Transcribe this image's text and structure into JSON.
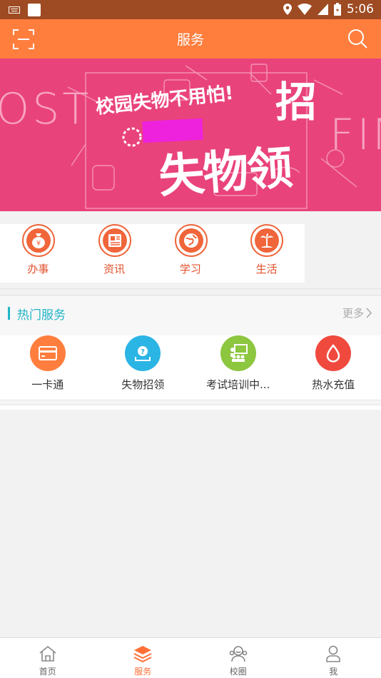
{
  "status_bar": {
    "time": "5:06"
  },
  "app_bar": {
    "title": "服务"
  },
  "banner": {
    "headline": "校园失物不用怕!",
    "big1": "招",
    "big2": "失物领",
    "bg_left": "OST",
    "bg_right": "FIN"
  },
  "categories": [
    {
      "label": "办事",
      "icon": "money-bag-icon"
    },
    {
      "label": "资讯",
      "icon": "news-icon"
    },
    {
      "label": "学习",
      "icon": "globe-icon"
    },
    {
      "label": "生活",
      "icon": "palm-tree-icon"
    }
  ],
  "hot_services": {
    "title": "热门服务",
    "more": "更多",
    "items": [
      {
        "label": "一卡通",
        "icon": "card-icon",
        "color": "#ff7e3e"
      },
      {
        "label": "失物招领",
        "icon": "lost-found-icon",
        "color": "#2bb5e5"
      },
      {
        "label": "考试培训中...",
        "icon": "classroom-icon",
        "color": "#8dc63f"
      },
      {
        "label": "热水充值",
        "icon": "water-drop-icon",
        "color": "#f04a3e"
      }
    ]
  },
  "bottom_nav": [
    {
      "label": "首页",
      "icon": "home-icon"
    },
    {
      "label": "服务",
      "icon": "layers-icon"
    },
    {
      "label": "校圈",
      "icon": "community-icon"
    },
    {
      "label": "我",
      "icon": "user-icon"
    }
  ],
  "colors": {
    "accent": "#ff7e3e",
    "teal": "#21b5c8",
    "banner": "#e9437c"
  }
}
